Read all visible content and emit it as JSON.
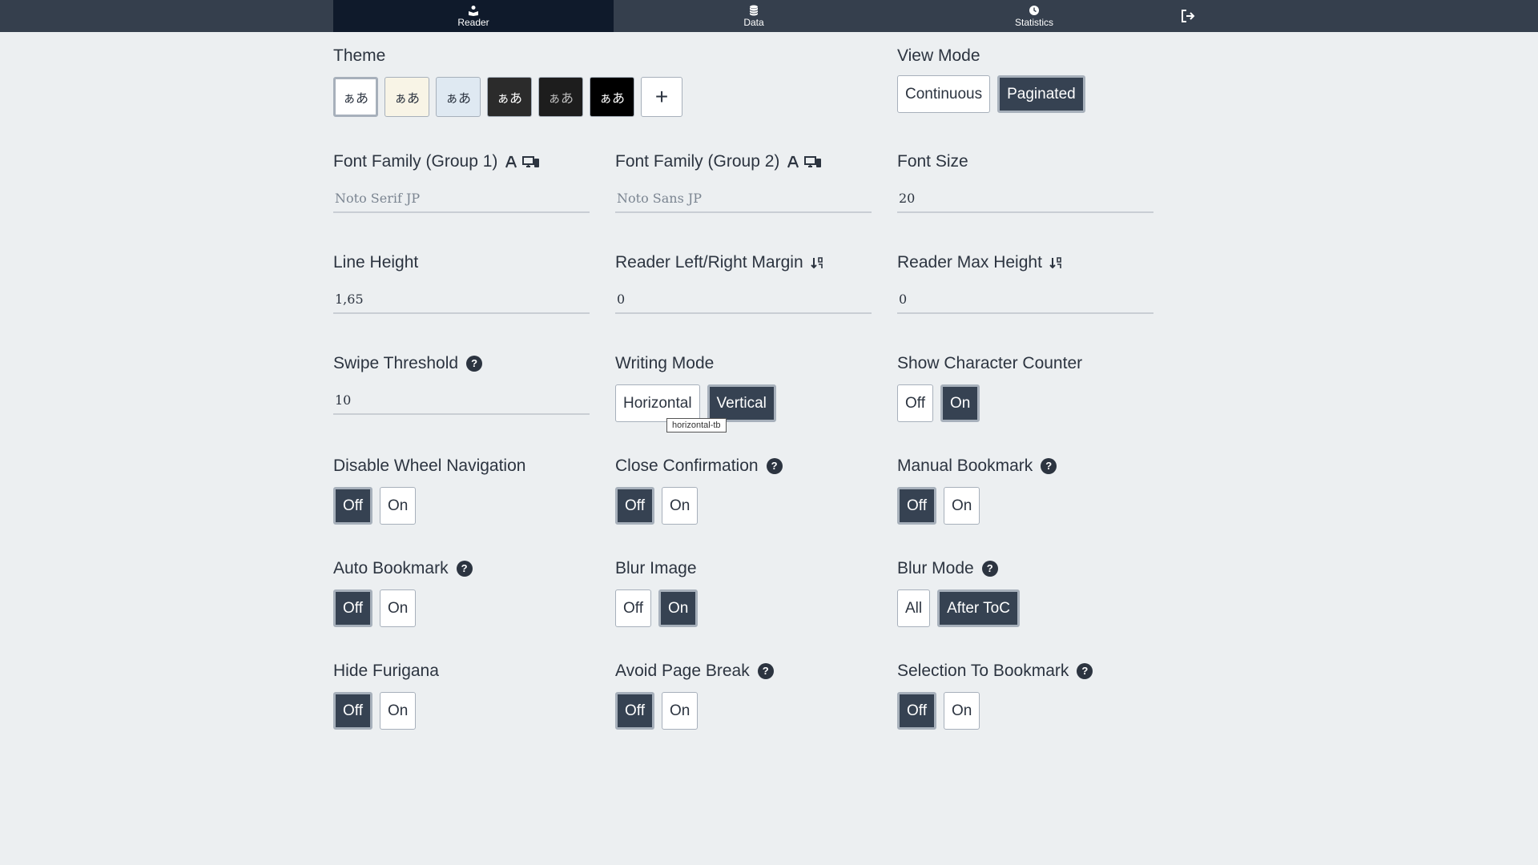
{
  "nav": {
    "tabs": [
      {
        "label": "Reader",
        "icon": "book-reader-icon"
      },
      {
        "label": "Data",
        "icon": "database-icon"
      },
      {
        "label": "Statistics",
        "icon": "clock-icon"
      }
    ],
    "logout_icon": "sign-out-icon"
  },
  "colors": {
    "nav_bg": "#353f4d",
    "nav_active": "#0f1a2b",
    "page_bg": "#eceff1",
    "selected_button": "#364252"
  },
  "settings": {
    "theme": {
      "label": "Theme",
      "swatches": [
        {
          "text": "ぁあ",
          "bg": "#ffffff",
          "fg": "#2c3440",
          "selected": true
        },
        {
          "text": "ぁあ",
          "bg": "#f8f4e6",
          "fg": "#2c3440",
          "selected": false
        },
        {
          "text": "ぁあ",
          "bg": "#dfe9f2",
          "fg": "#2c3440",
          "selected": false
        },
        {
          "text": "ぁあ",
          "bg": "#2b2b2b",
          "fg": "#ffffff",
          "selected": false
        },
        {
          "text": "ぁあ",
          "bg": "#1d1d1d",
          "fg": "#bdbdbd",
          "selected": false
        },
        {
          "text": "ぁあ",
          "bg": "#000000",
          "fg": "#ffffff",
          "selected": false
        }
      ],
      "add_label": "+"
    },
    "view_mode": {
      "label": "View Mode",
      "options": [
        "Continuous",
        "Paginated"
      ],
      "selected": "Paginated"
    },
    "font_family_1": {
      "label": "Font Family (Group 1)",
      "placeholder": "Noto Serif JP"
    },
    "font_family_2": {
      "label": "Font Family (Group 2)",
      "placeholder": "Noto Sans JP"
    },
    "font_size": {
      "label": "Font Size",
      "value": "20"
    },
    "line_height": {
      "label": "Line Height",
      "value": "1,65"
    },
    "margin": {
      "label": "Reader Left/Right Margin",
      "value": "0"
    },
    "max_height": {
      "label": "Reader Max Height",
      "value": "0"
    },
    "swipe_threshold": {
      "label": "Swipe Threshold",
      "value": "10"
    },
    "writing_mode": {
      "label": "Writing Mode",
      "options": [
        "Horizontal",
        "Vertical"
      ],
      "selected": "Vertical",
      "tooltip": "horizontal-tb"
    },
    "char_counter": {
      "label": "Show Character Counter",
      "options": [
        "Off",
        "On"
      ],
      "selected": "On"
    },
    "wheel_nav": {
      "label": "Disable Wheel Navigation",
      "options": [
        "Off",
        "On"
      ],
      "selected": "Off"
    },
    "close_confirm": {
      "label": "Close Confirmation",
      "options": [
        "Off",
        "On"
      ],
      "selected": "Off"
    },
    "manual_bookmark": {
      "label": "Manual Bookmark",
      "options": [
        "Off",
        "On"
      ],
      "selected": "Off"
    },
    "auto_bookmark": {
      "label": "Auto Bookmark",
      "options": [
        "Off",
        "On"
      ],
      "selected": "Off"
    },
    "blur_image": {
      "label": "Blur Image",
      "options": [
        "Off",
        "On"
      ],
      "selected": "On"
    },
    "blur_mode": {
      "label": "Blur Mode",
      "options": [
        "All",
        "After ToC"
      ],
      "selected": "After ToC"
    },
    "hide_furigana": {
      "label": "Hide Furigana",
      "options": [
        "Off",
        "On"
      ],
      "selected": "Off"
    },
    "avoid_page_break": {
      "label": "Avoid Page Break",
      "options": [
        "Off",
        "On"
      ],
      "selected": "Off"
    },
    "selection_bookmark": {
      "label": "Selection To Bookmark",
      "options": [
        "Off",
        "On"
      ],
      "selected": "Off"
    }
  }
}
